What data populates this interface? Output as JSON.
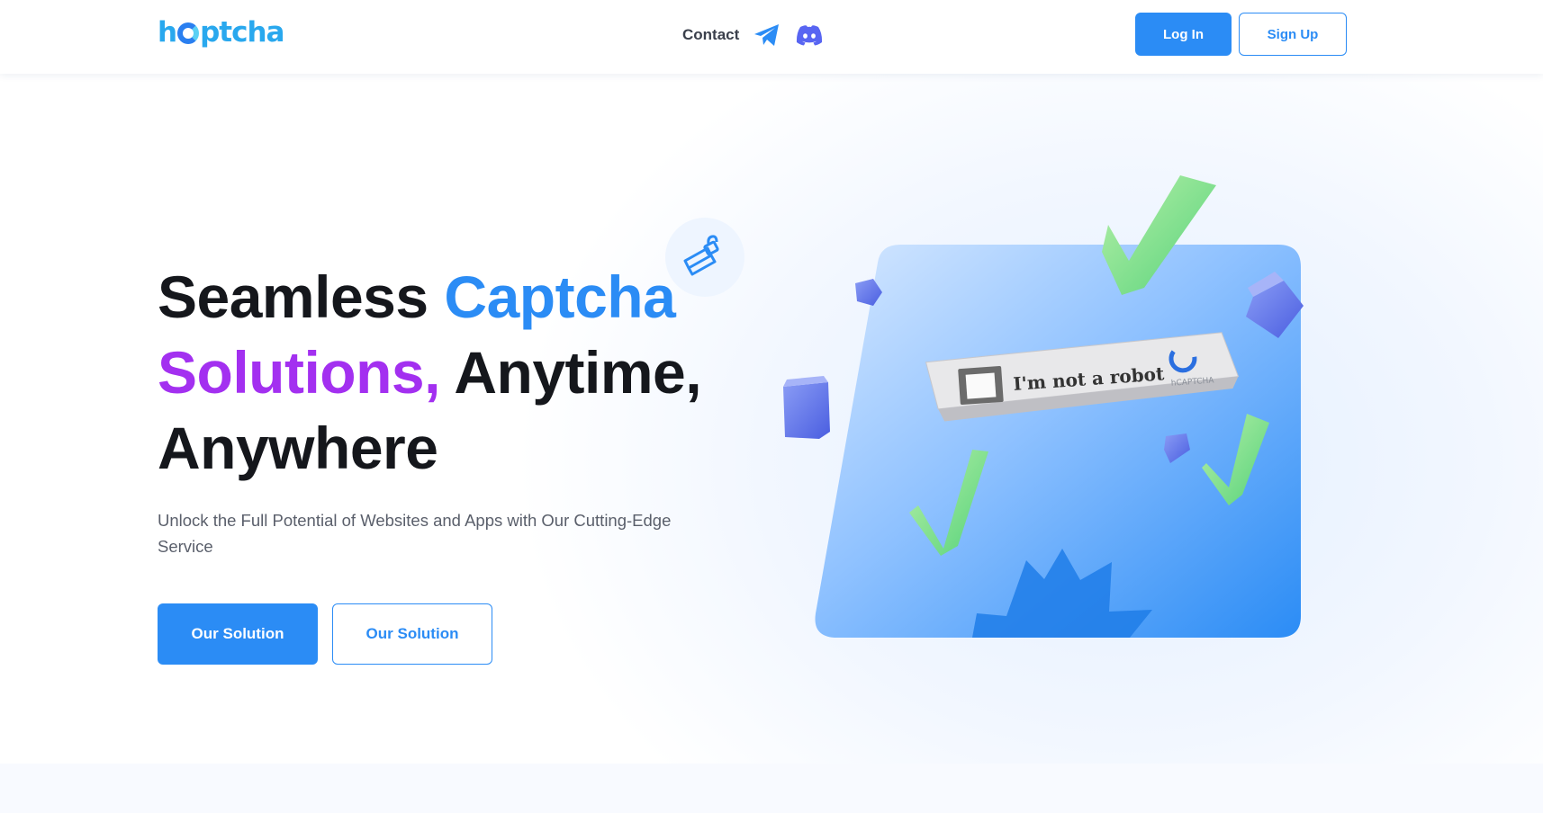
{
  "header": {
    "logo_text": "hCaptcha",
    "nav": {
      "contact_label": "Contact"
    },
    "icons": [
      "telegram-icon",
      "discord-icon"
    ],
    "login_label": "Log In",
    "signup_label": "Sign Up"
  },
  "hero": {
    "headline": {
      "part1": "Seamless ",
      "part2": "Captcha",
      "part3": "Solutions,",
      "part4": " Anytime, Anywhere"
    },
    "subtext": "Unlock the Full Potential of Websites and Apps with Our Cutting-Edge Service",
    "primary_button": "Our Solution",
    "secondary_button": "Our Solution",
    "captcha_widget": {
      "label": "I'm not a robot",
      "brand": "hCAPTCHA"
    }
  },
  "colors": {
    "accent": "#2b8cf5",
    "purple": "#a330f0",
    "text_dark": "#15171c",
    "text_muted": "#5a5f6b"
  }
}
